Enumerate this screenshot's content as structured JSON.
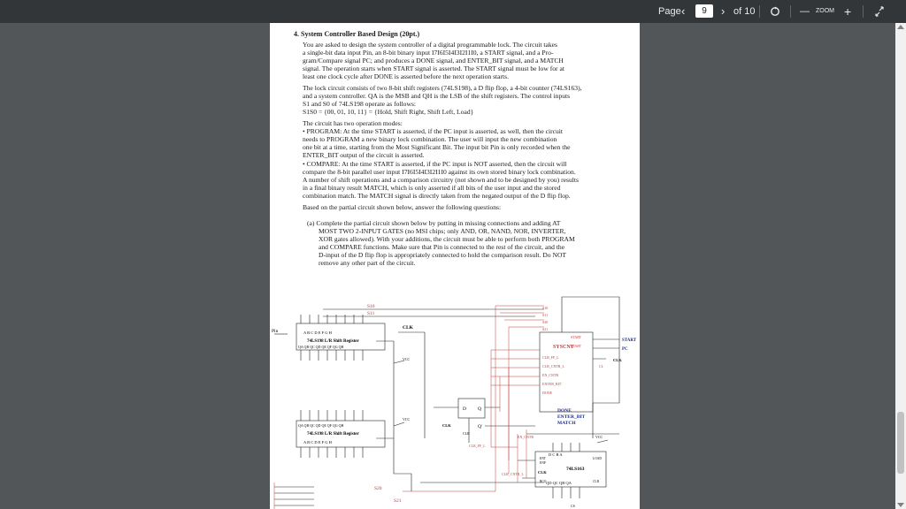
{
  "toolbar": {
    "page_label": "Page",
    "page_number": "9",
    "page_total": "of 10",
    "zoom_label": "ZOOM",
    "zoom_out": "—",
    "zoom_in": "+"
  },
  "document": {
    "section_title": "4.  System Controller Based Design (20pt.)",
    "para1": [
      "You are asked to design the system controller of a digital programmable lock.  The circuit takes",
      "a single-bit data input Pin, an 8-bit binary input I7I6I5I4I3I2I1I0, a START signal, and a Pro-",
      "gram/Compare signal PC; and produces a DONE signal, and ENTER_BIT signal, and a MATCH",
      "signal.  The operation starts when START signal is asserted.  The START signal must be low for at",
      "least one clock cycle after DONE is asserted before the next operation starts."
    ],
    "para2": [
      "The lock circuit consists of two 8-bit shift registers (74LS198), a D flip flop, a 4-bit counter (74LS163),",
      "and a system controller. QA is the MSB and QH is the LSB of the shift registers. The control inputs",
      "S1 and S0 of 74LS198 operate as follows:",
      "S1S0 = {00, 01, 10, 11} = {Hold, Shift Right, Shift Left, Load}"
    ],
    "modes_intro": "The circuit has two operation modes:",
    "program": [
      "• PROGRAM: At the time START is asserted, if the PC input is asserted, as well, then the circuit",
      "needs to PROGRAM a new binary lock combination.  The user will input the new combination",
      "one bit at a time, starting from the Most Significant Bit. The input bit Pin is only recorded when the",
      "ENTER_BIT output of the circuit is asserted."
    ],
    "compare": [
      "• COMPARE: At the time START is asserted, if the PC input is NOT asserted, then the circuit will",
      "compare the 8-bit parallel user input I7I6I5I4I3I2I1I0 against its own stored binary lock combination.",
      "A number of shift operations and a comparison circuitry (not shown and to be designed by you) results",
      "in a final binary result MATCH, which is only asserted if all bits of the user input and the stored",
      "combination match. The MATCH signal is directly taken from the negated output of the D flip flop."
    ],
    "based_on": "Based on the partial circuit shown below, answer the following questions:",
    "part_a": [
      "(a)  Complete the partial circuit shown below by putting in missing connections and adding AT",
      "MOST TWO 2-INPUT GATES (no MSI chips; only AND, OR, NAND, NOR, INVERTER,",
      "XOR gates allowed). With your additions, the circuit must be able to perform both PROGRAM",
      "and COMPARE functions.  Make sure that Pin is connected to the rest of the circuit, and the",
      "D-input of the D flip flop is appropriately connected to hold the comparison result.  Do NOT",
      "remove any other part of the circuit."
    ]
  },
  "circuit": {
    "pin_label": "Pin",
    "s10": "S10",
    "s11": "S11",
    "s20": "S20",
    "s21": "S21",
    "clk": "CLK",
    "reg_top_label": "74LS198 L/R Shift Register",
    "reg_top_inputs": "A  B  C  D  E  F  G  H",
    "reg_top_outputs": "QA QB QC QD QE QF QG QH",
    "reg_bot_label": "74LS198 L/R Shift Register",
    "reg_bot_inputs": "A  B  C  D  E  F  G  H",
    "reg_bot_outputs": "QA QB QC QD QE QF QG QH",
    "vcc": "VCC",
    "sysctrl_label": "SYSCNT",
    "sc_start": "START",
    "sc_pc": "START",
    "sc_pins": [
      "CLR_FF_L",
      "CLR_CNTR_L",
      "EN_CNTR",
      "ENTER_BIT",
      "DONE"
    ],
    "sc_s": [
      "S10",
      "S11",
      "S20",
      "S21"
    ],
    "cl_label": "CL",
    "start_out": "START",
    "pc_out": "PC",
    "clk_in": "CLK",
    "dff_d": "D",
    "dff_q": "Q",
    "dff_qbar": "Q'",
    "dff_clr": "CLR",
    "clr_ff": "CLR_FF_L",
    "done_out": "DONE",
    "enter_bit_out": "ENTER_BIT",
    "match_out": "MATCH",
    "counter_label": "74LS163",
    "counter_inputs": "D  C  B  A",
    "counter_outputs": "QD QC QB QA",
    "counter_clk": "CLK",
    "counter_clr": "CLR",
    "en_cntr": "EN_CNTR",
    "clr_cntr": "CLR_CNTR_L",
    "rco": "RCO",
    "ent": "ENT",
    "enp": "ENP",
    "load": "LOAD",
    "cs": "CS"
  }
}
